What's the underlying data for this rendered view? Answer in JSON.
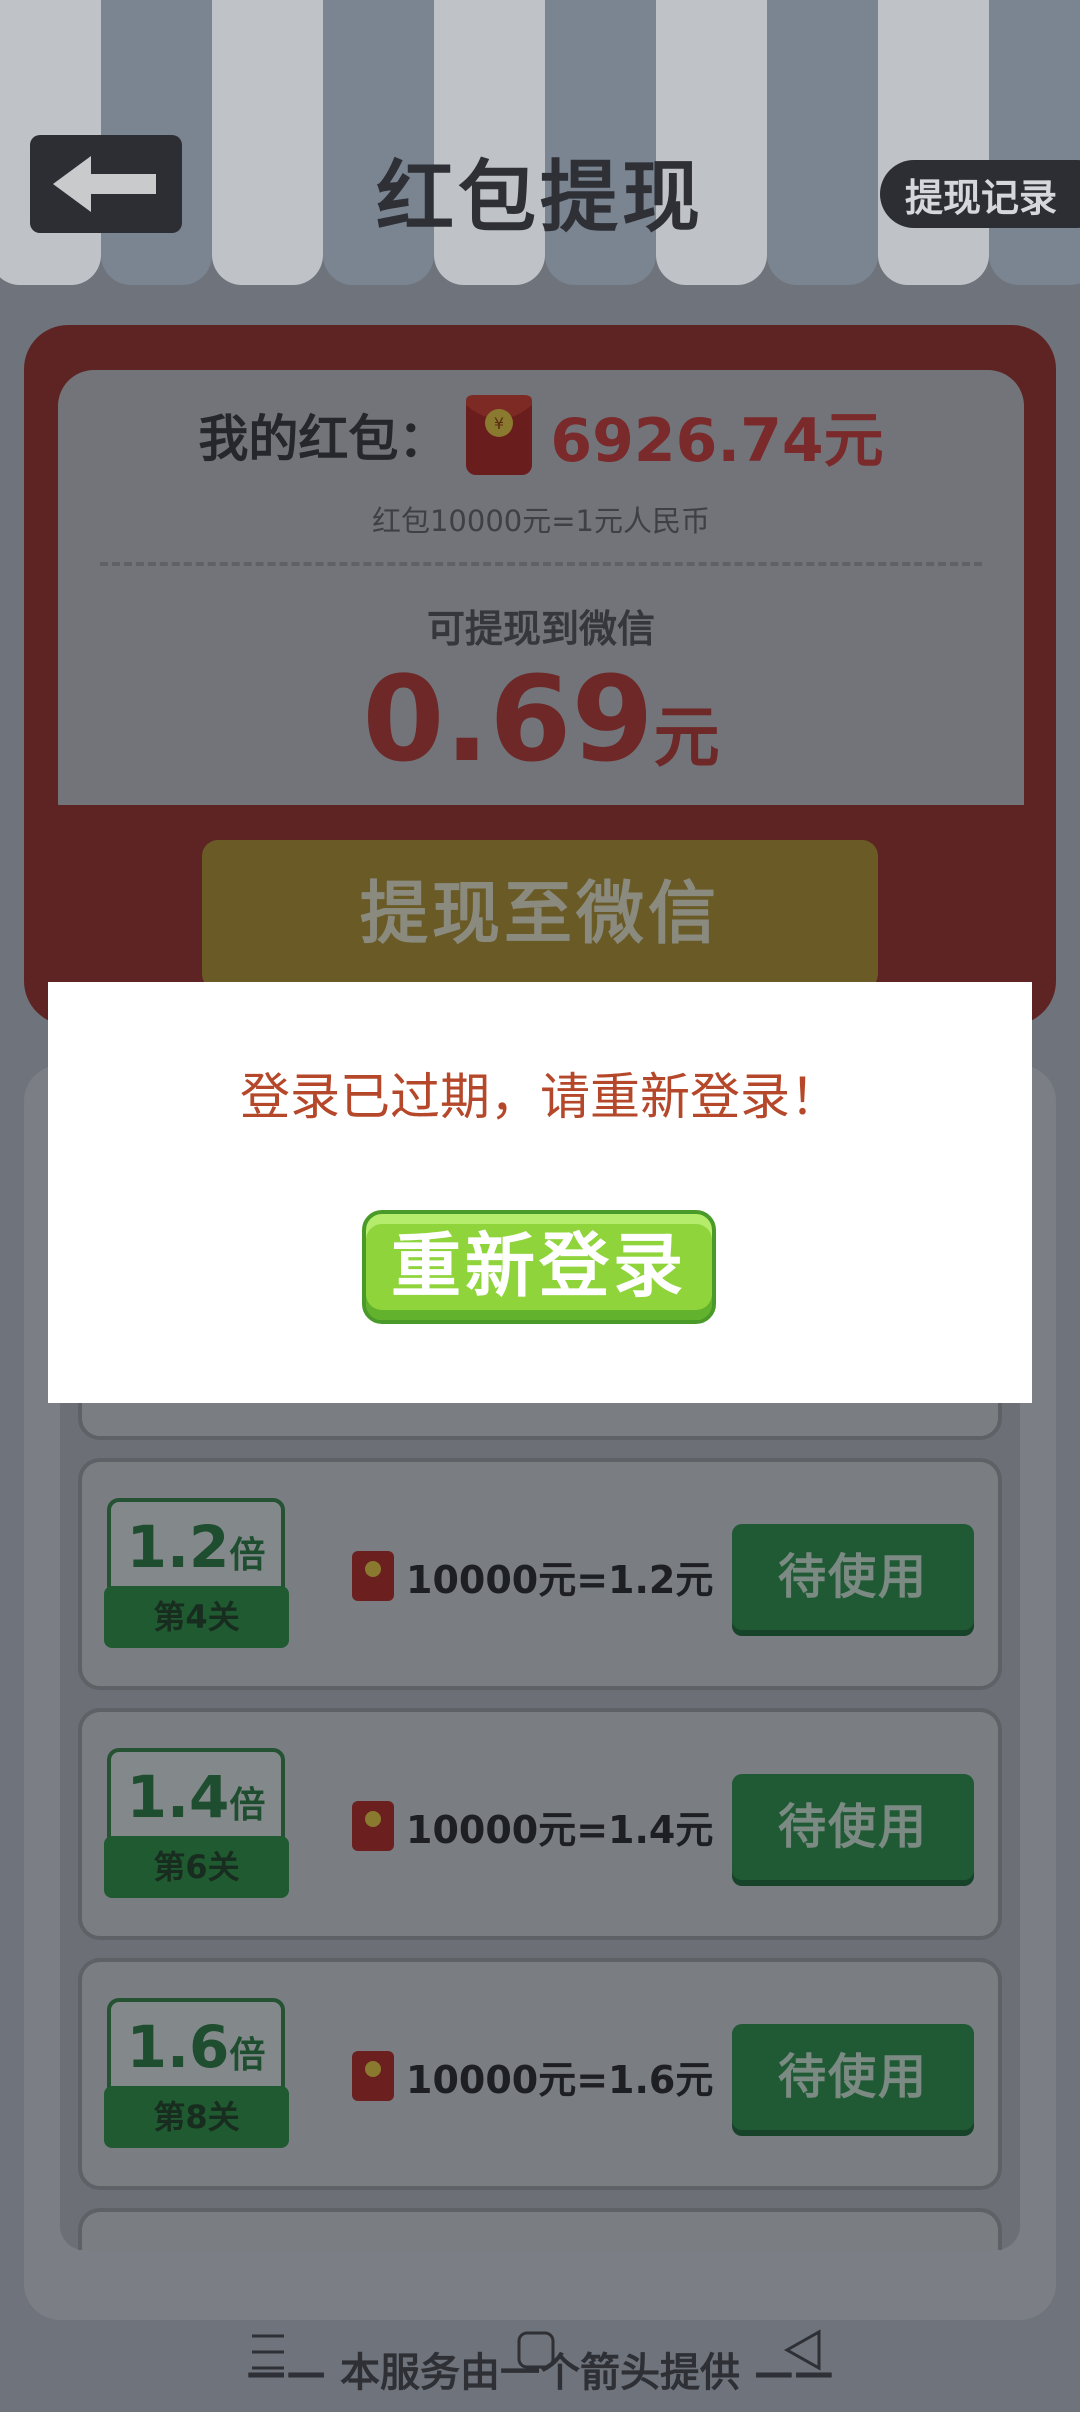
{
  "header": {
    "title": "红包提现",
    "record_label": "提现记录"
  },
  "balance": {
    "my_label": "我的红包：",
    "my_amount": "6926.74元",
    "rate_text": "红包10000元=1元人民币",
    "wx_label": "可提现到微信",
    "wx_amount": "0.69",
    "wx_unit": "元",
    "withdraw_label": "提现至微信"
  },
  "rows": [
    {
      "multiplier": "1.2",
      "multiplier_unit": "倍",
      "level": "第4关",
      "rate": "10000元=1.2元",
      "button": "待使用"
    },
    {
      "multiplier": "1.4",
      "multiplier_unit": "倍",
      "level": "第6关",
      "rate": "10000元=1.4元",
      "button": "待使用"
    },
    {
      "multiplier": "1.6",
      "multiplier_unit": "倍",
      "level": "第8关",
      "rate": "10000元=1.6元",
      "button": "待使用"
    }
  ],
  "footer": {
    "text": "—— 本服务由一个箭头提供 ——"
  },
  "dialog": {
    "message": "登录已过期，请重新登录！",
    "button_label": "重新登录"
  },
  "colors": {
    "accent_red": "#d9383a",
    "accent_green": "#2fa857",
    "relogin_green": "#8fd43b",
    "dialog_text": "#b5482a"
  },
  "icons": [
    "back-arrow-icon",
    "red-envelope-icon",
    "menu-nav-icon",
    "home-nav-icon",
    "back-nav-icon"
  ]
}
